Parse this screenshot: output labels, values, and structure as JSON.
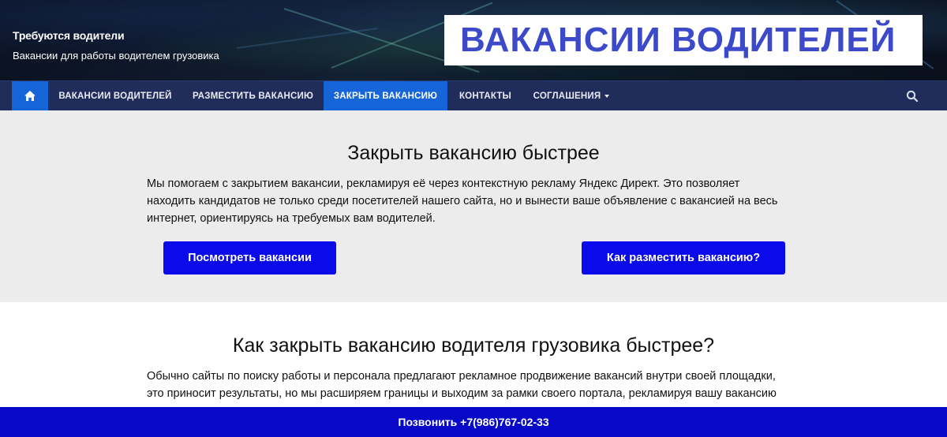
{
  "header": {
    "site_title": "Требуются водители",
    "tagline": "Вакансии для работы водителем грузовика",
    "banner_text": "ВАКАНСИИ ВОДИТЕЛЕЙ"
  },
  "nav": {
    "home_icon": "home-icon",
    "items": [
      {
        "label": "Вакансии водителей"
      },
      {
        "label": "Разместить вакансию"
      },
      {
        "label": "Закрыть вакансию"
      },
      {
        "label": "Контакты"
      },
      {
        "label": "Соглашения"
      }
    ],
    "active": "Закрыть вакансию",
    "search_icon": "search-icon"
  },
  "section1": {
    "heading": "Закрыть вакансию быстрее",
    "lines": [
      "Мы помогаем с закрытием вакансии, рекламируя её через контекстную рекламу Яндекс Директ. Это позволяет",
      "находить кандидатов не только среди посетителей нашего сайта, но и вынести ваше объявление с вакансией на весь",
      "интернет, ориентируясь на требуемых вам водителей."
    ],
    "btn_view": "Посмотреть вакансии",
    "btn_how": "Как разместить вакансию?"
  },
  "section2": {
    "heading": "Как закрыть вакансию водителя грузовика быстрее?",
    "lines": [
      "Обычно сайты по поиску работы и персонала предлагают рекламное продвижение вакансий внутри своей площадки,",
      "это приносит результаты, но мы расширяем границы и выходим за рамки своего портала, рекламируя вашу вакансию"
    ]
  },
  "callbar": {
    "label": "Позвонить +7(986)767-02-33"
  },
  "colors": {
    "nav_bg": "#202d5a",
    "active": "#1665d8",
    "button": "#0a0aea",
    "callbar": "#0808c8",
    "banner_text": "#3c49c9"
  }
}
